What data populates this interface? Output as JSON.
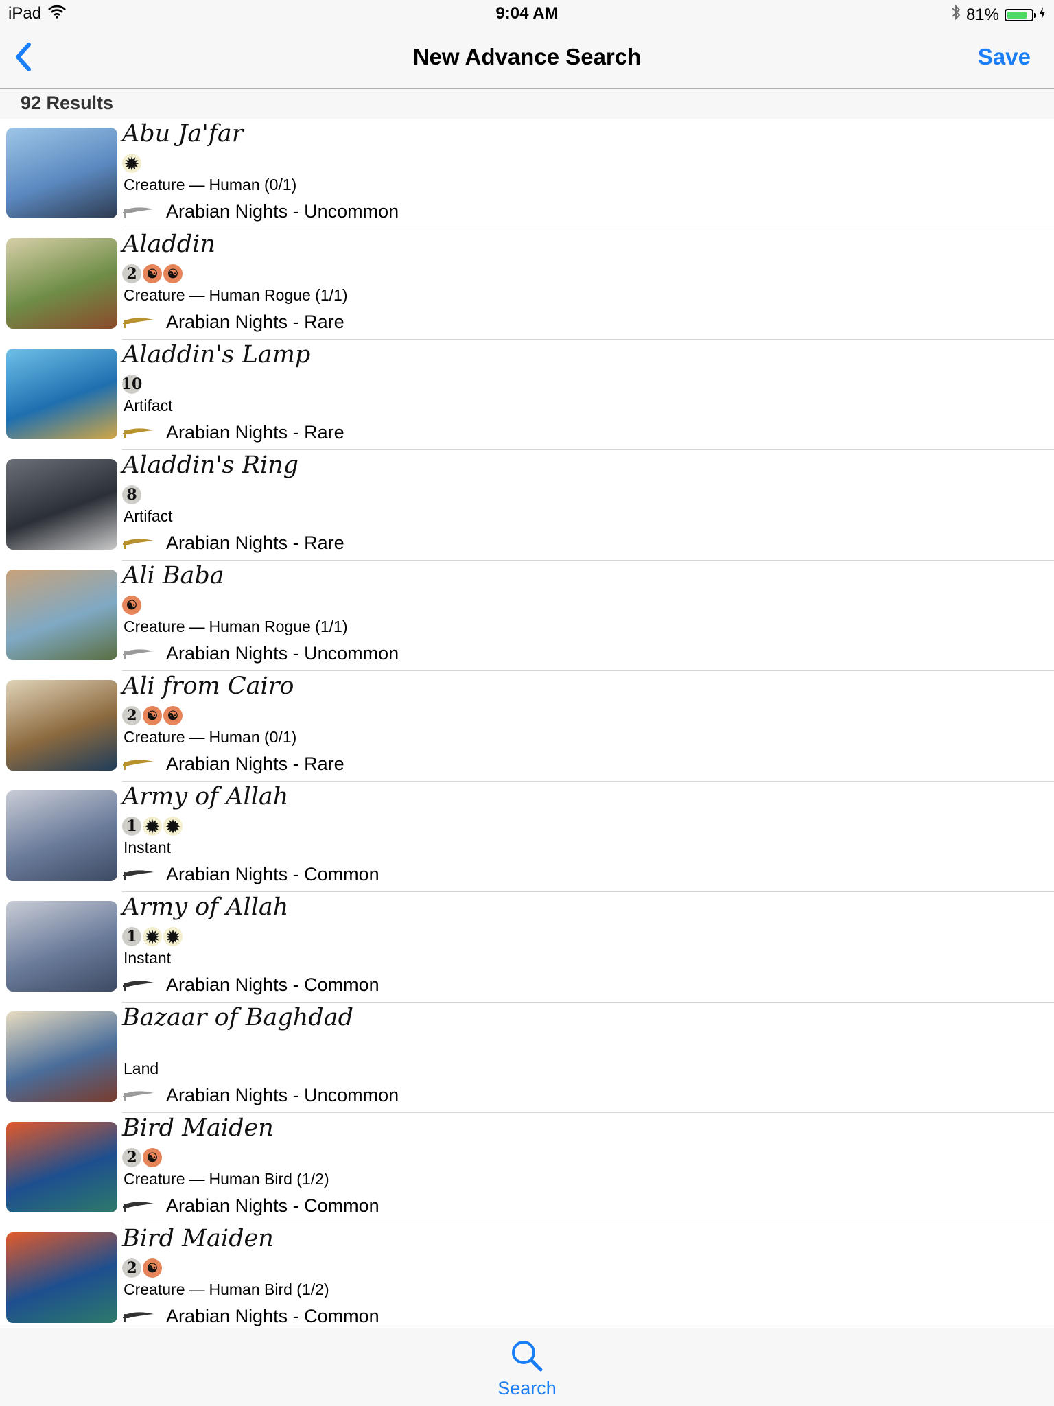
{
  "status_bar": {
    "device": "iPad",
    "time": "9:04 AM",
    "battery": "81%",
    "battery_level": 0.81
  },
  "nav": {
    "title": "New Advance Search",
    "save_label": "Save"
  },
  "results": {
    "count_label": "92 Results"
  },
  "colors": {
    "accent": "#1a7ef7",
    "battery": "#4cd964"
  },
  "cards": [
    {
      "name": "Abu Ja'far",
      "mana": [
        "W"
      ],
      "type": "Creature",
      "subtype": "Human (0/1)",
      "set": "Arabian Nights - Uncommon",
      "rarity_icon": "silver-scimitar-icon"
    },
    {
      "name": "Aladdin",
      "mana": [
        "2",
        "R",
        "R"
      ],
      "type": "Creature",
      "subtype": "Human Rogue (1/1)",
      "set": "Arabian Nights - Rare",
      "rarity_icon": "gold-scimitar-icon"
    },
    {
      "name": "Aladdin's Lamp",
      "mana": [
        "10"
      ],
      "type": "Artifact",
      "subtype": "",
      "set": "Arabian Nights - Rare",
      "rarity_icon": "gold-scimitar-icon"
    },
    {
      "name": "Aladdin's Ring",
      "mana": [
        "8"
      ],
      "type": "Artifact",
      "subtype": "",
      "set": "Arabian Nights - Rare",
      "rarity_icon": "gold-scimitar-icon"
    },
    {
      "name": "Ali Baba",
      "mana": [
        "R"
      ],
      "type": "Creature",
      "subtype": "Human Rogue (1/1)",
      "set": "Arabian Nights - Uncommon",
      "rarity_icon": "silver-scimitar-icon"
    },
    {
      "name": "Ali from Cairo",
      "mana": [
        "2",
        "R",
        "R"
      ],
      "type": "Creature",
      "subtype": "Human (0/1)",
      "set": "Arabian Nights - Rare",
      "rarity_icon": "gold-scimitar-icon"
    },
    {
      "name": "Army of Allah",
      "mana": [
        "1",
        "W",
        "W"
      ],
      "type": "Instant",
      "subtype": "",
      "set": "Arabian Nights - Common",
      "rarity_icon": "black-scimitar-icon"
    },
    {
      "name": "Army of Allah",
      "mana": [
        "1",
        "W",
        "W"
      ],
      "type": "Instant",
      "subtype": "",
      "set": "Arabian Nights - Common",
      "rarity_icon": "black-scimitar-icon"
    },
    {
      "name": "Bazaar of Baghdad",
      "mana": [],
      "type": "Land",
      "subtype": "",
      "set": "Arabian Nights - Uncommon",
      "rarity_icon": "silver-scimitar-icon"
    },
    {
      "name": "Bird Maiden",
      "mana": [
        "2",
        "R"
      ],
      "type": "Creature",
      "subtype": "Human Bird (1/2)",
      "set": "Arabian Nights - Common",
      "rarity_icon": "black-scimitar-icon"
    },
    {
      "name": "Bird Maiden",
      "mana": [
        "2",
        "R"
      ],
      "type": "Creature",
      "subtype": "Human Bird (1/2)",
      "set": "Arabian Nights - Common",
      "rarity_icon": "black-scimitar-icon"
    }
  ],
  "tab_bar": {
    "search_label": "Search"
  }
}
